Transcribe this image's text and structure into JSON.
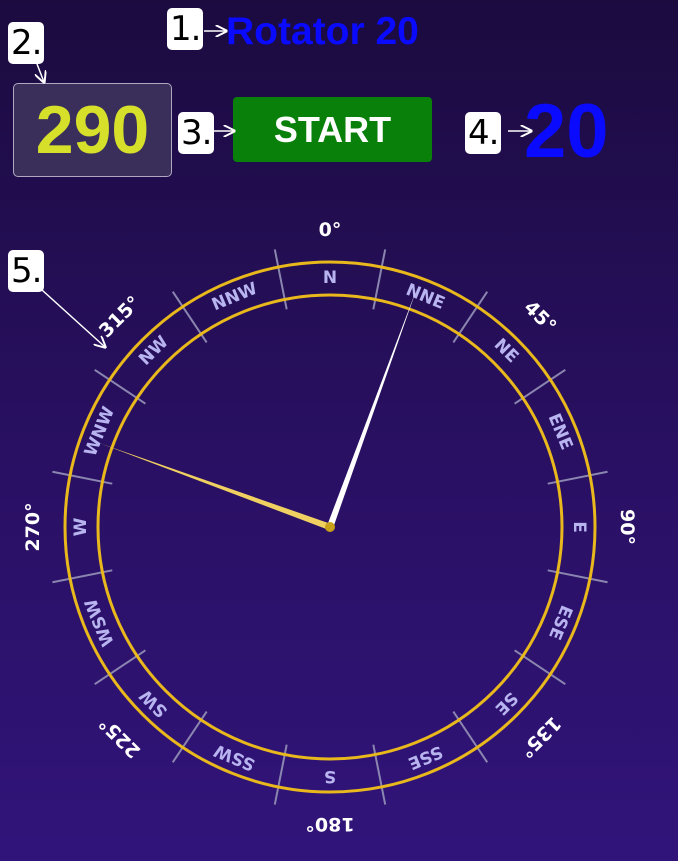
{
  "app": {
    "title": "Rotator 20"
  },
  "controls": {
    "target_value": "290",
    "start_label": "START",
    "current_value": "20"
  },
  "callouts": [
    "1.",
    "2.",
    "3.",
    "4.",
    "5."
  ],
  "compass": {
    "target_heading": 290,
    "current_heading": 20,
    "degree_labels": [
      {
        "deg": 0,
        "text": "0°"
      },
      {
        "deg": 45,
        "text": "45°"
      },
      {
        "deg": 90,
        "text": "90°"
      },
      {
        "deg": 135,
        "text": "135°"
      },
      {
        "deg": 180,
        "text": "180°"
      },
      {
        "deg": 225,
        "text": "225°"
      },
      {
        "deg": 270,
        "text": "270°"
      },
      {
        "deg": 315,
        "text": "315°"
      }
    ],
    "points": [
      "N",
      "NNE",
      "NE",
      "ENE",
      "E",
      "ESE",
      "SE",
      "SSE",
      "S",
      "SSW",
      "SW",
      "WSW",
      "W",
      "WNW",
      "NW",
      "NNW"
    ]
  },
  "colors": {
    "ring": "#e8b81c",
    "target_needle": "#f0d060",
    "current_needle": "#ffffff",
    "point_label": "#b8b4f0",
    "degree_label": "#ffffff",
    "tick": "#8a86b0"
  }
}
